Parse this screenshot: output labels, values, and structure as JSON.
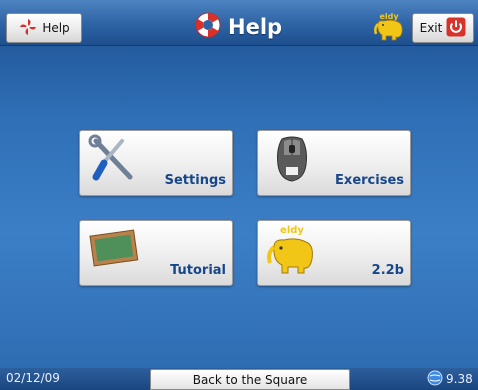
{
  "header": {
    "help_label": "Help",
    "title": "Help",
    "exit_label": "Exit",
    "brand_logo_text": "eldy"
  },
  "tiles": [
    {
      "label": "Settings",
      "icon": "tools-icon"
    },
    {
      "label": "Exercises",
      "icon": "mouse-icon"
    },
    {
      "label": "Tutorial",
      "icon": "chalkboard-icon"
    },
    {
      "label": "2.2b",
      "icon": "eldy-logo-icon"
    }
  ],
  "footer": {
    "date": "02/12/09",
    "back_label": "Back to the Square",
    "status_value": "9.38"
  },
  "colors": {
    "accent": "#17478a",
    "background": "#2f6fb6",
    "exit_red": "#d8332a"
  }
}
